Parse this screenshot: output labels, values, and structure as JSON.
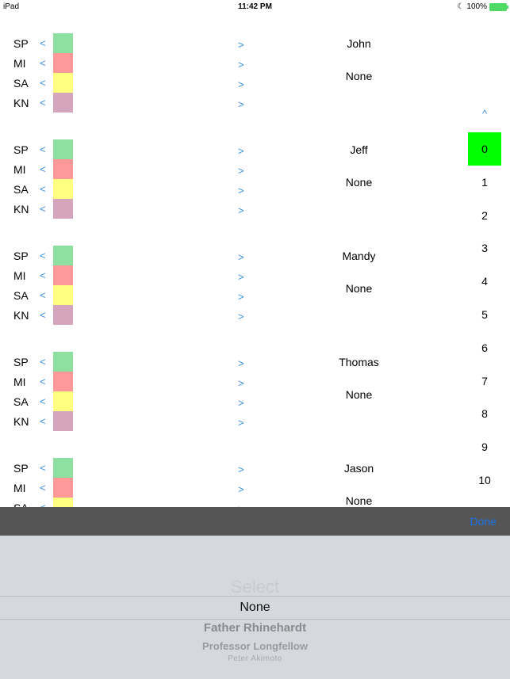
{
  "status_bar": {
    "device": "iPad",
    "time": "11:42 PM",
    "battery": "100%"
  },
  "row_labels": [
    "SP",
    "MI",
    "SA",
    "KN"
  ],
  "colors": {
    "SP": "#8ee0a0",
    "MI": "#ff9999",
    "SA": "#ffff80",
    "KN": "#d4a5bc",
    "selected": "#00ff00",
    "accent": "#3a8fe0"
  },
  "arrows": {
    "decrement": "<",
    "increment": ">",
    "up": "^"
  },
  "students": [
    {
      "name": "John",
      "assignment": "None"
    },
    {
      "name": "Jeff",
      "assignment": "None"
    },
    {
      "name": "Mandy",
      "assignment": "None"
    },
    {
      "name": "Thomas",
      "assignment": "None"
    },
    {
      "name": "Jason",
      "assignment": "None"
    }
  ],
  "number_list": {
    "selected": "0",
    "items": [
      "0",
      "1",
      "2",
      "3",
      "4",
      "5",
      "6",
      "7",
      "8",
      "9",
      "10"
    ]
  },
  "toolbar": {
    "done_label": "Done"
  },
  "picker": {
    "title": "Select",
    "selected": "None",
    "options": [
      "Father Rhinehardt",
      "Professor Longfellow",
      "Peter Akimoto"
    ]
  }
}
